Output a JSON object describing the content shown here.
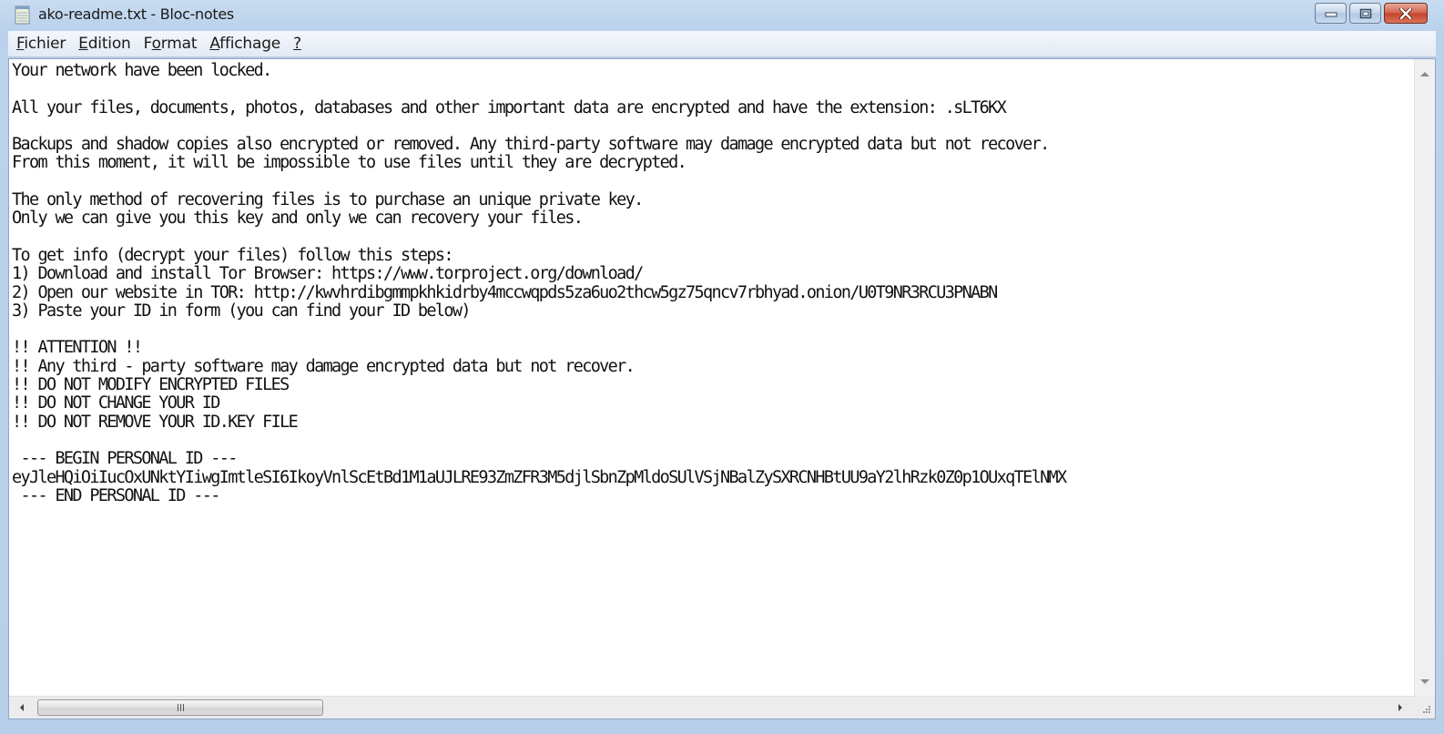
{
  "window": {
    "title": "ako-readme.txt - Bloc-notes",
    "app_icon": "notepad-icon",
    "controls": {
      "minimize": "minimize-icon",
      "maximize": "maximize-icon",
      "close": "close-icon"
    }
  },
  "menubar": {
    "items": [
      {
        "accel": "F",
        "rest": "ichier",
        "pre": ""
      },
      {
        "accel": "E",
        "rest": "dition",
        "pre": ""
      },
      {
        "pre": "F",
        "accel": "o",
        "rest": "rmat"
      },
      {
        "accel": "A",
        "rest": "ffichage",
        "pre": ""
      },
      {
        "accel": "?",
        "rest": "",
        "pre": ""
      }
    ]
  },
  "document": {
    "lines": [
      "Your network have been locked.",
      "",
      "All your files, documents, photos, databases and other important data are encrypted and have the extension: .sLT6KX",
      "",
      "Backups and shadow copies also encrypted or removed. Any third-party software may damage encrypted data but not recover.",
      "From this moment, it will be impossible to use files until they are decrypted.",
      "",
      "The only method of recovering files is to purchase an unique private key.",
      "Only we can give you this key and only we can recovery your files.",
      "",
      "To get info (decrypt your files) follow this steps:",
      "1) Download and install Tor Browser: https://www.torproject.org/download/",
      "2) Open our website in TOR: http://kwvhrdibgmmpkhkidrby4mccwqpds5za6uo2thcw5gz75qncv7rbhyad.onion/U0T9NR3RCU3PNABN",
      "3) Paste your ID in form (you can find your ID below)",
      "",
      "!! ATTENTION !!",
      "!! Any third - party software may damage encrypted data but not recover.",
      "!! DO NOT MODIFY ENCRYPTED FILES",
      "!! DO NOT CHANGE YOUR ID",
      "!! DO NOT REMOVE YOUR ID.KEY FILE",
      "",
      " --- BEGIN PERSONAL ID ---",
      "eyJleHQiOiIucOxUNktYIiwgImtleSI6IkoyVnlScEtBd1M1aUJLRE93ZmZFR3M5djlSbnZpMldoSUlVSjNBalZySXRCNHBtUU9aY2lhRzk0Z0p1OUxqTElNMX",
      " --- END PERSONAL ID ---"
    ]
  },
  "scrollbars": {
    "vertical": {
      "up": "scroll-up-arrow-icon",
      "down": "scroll-down-arrow-icon"
    },
    "horizontal": {
      "left": "scroll-left-arrow-icon",
      "right": "scroll-right-arrow-icon",
      "position_fraction": 0.0,
      "thumb_fraction": 0.21
    }
  }
}
